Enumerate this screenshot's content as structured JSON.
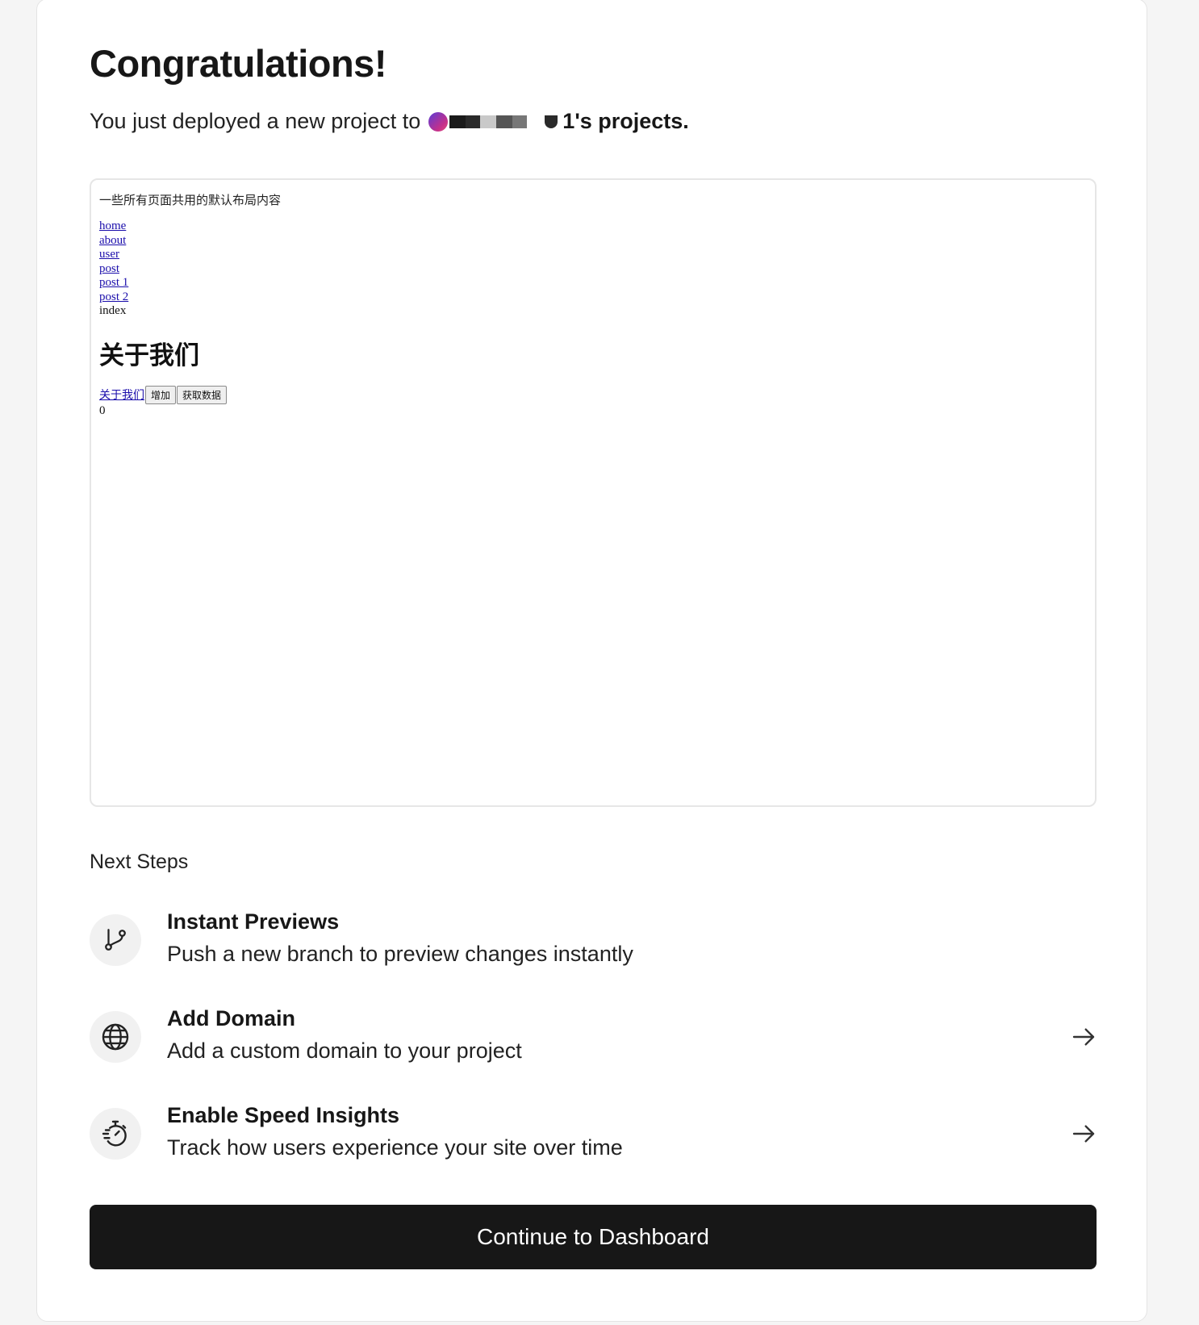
{
  "header": {
    "title": "Congratulations!",
    "deployed_prefix": "You just deployed a new project to",
    "team_suffix": "1's projects."
  },
  "preview": {
    "layout_text": "一些所有页面共用的默认布局内容",
    "nav_links": [
      "home",
      "about",
      "user",
      "post",
      "post 1",
      "post 2"
    ],
    "nav_current": "index",
    "heading": "关于我们",
    "link_label": "关于我们",
    "buttons": [
      "增加",
      "获取数据"
    ],
    "count": "0"
  },
  "next_steps": {
    "label": "Next Steps",
    "items": [
      {
        "icon": "git-branch-icon",
        "title": "Instant Previews",
        "description": "Push a new branch to preview changes instantly",
        "has_arrow": false
      },
      {
        "icon": "globe-icon",
        "title": "Add Domain",
        "description": "Add a custom domain to your project",
        "has_arrow": true
      },
      {
        "icon": "stopwatch-icon",
        "title": "Enable Speed Insights",
        "description": "Track how users experience your site over time",
        "has_arrow": true
      }
    ]
  },
  "cta": {
    "label": "Continue to Dashboard"
  },
  "colors": {
    "cta_bg": "#171717",
    "page_bg": "#f5f5f5",
    "link": "#1a0dab"
  }
}
